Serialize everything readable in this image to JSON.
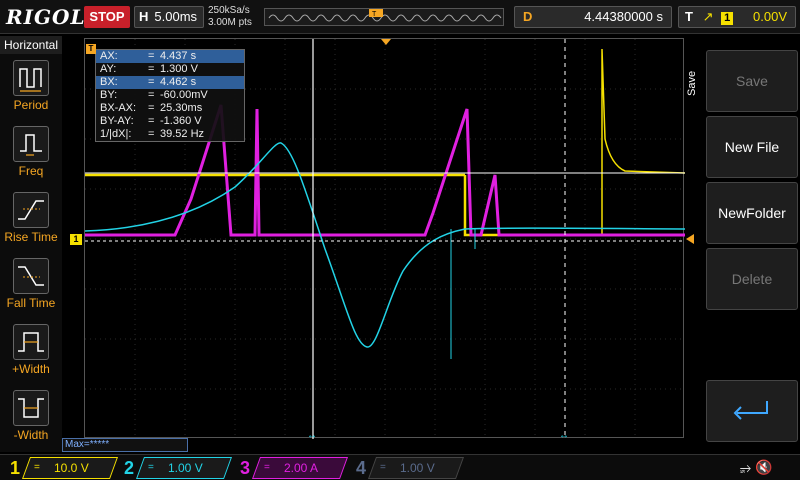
{
  "header": {
    "brand": "RIGOL",
    "run_state": "STOP",
    "timebase_label": "H",
    "timebase_value": "5.00ms",
    "sample_rate": "250kSa/s",
    "memory_depth": "3.00M pts",
    "delay_label": "D",
    "delay_value": "4.44380000 s",
    "trigger_label": "T",
    "trigger_source": "1",
    "trigger_level": "0.00V"
  },
  "left_menu": {
    "title": "Horizontal",
    "items": [
      {
        "label": "Period",
        "icon": "period-icon"
      },
      {
        "label": "Freq",
        "icon": "frequency-icon"
      },
      {
        "label": "Rise Time",
        "icon": "rise-time-icon"
      },
      {
        "label": "Fall Time",
        "icon": "fall-time-icon"
      },
      {
        "label": "+Width",
        "icon": "positive-width-icon"
      },
      {
        "label": "-Width",
        "icon": "negative-width-icon"
      }
    ]
  },
  "cursor_readout": [
    {
      "name": "AX:",
      "value": "4.437 s",
      "selected": true
    },
    {
      "name": "AY:",
      "value": "1.300 V",
      "selected": false
    },
    {
      "name": "BX:",
      "value": "4.462 s",
      "selected": true
    },
    {
      "name": "BY:",
      "value": "-60.00mV",
      "selected": false
    },
    {
      "name": "BX-AX:",
      "value": "25.30ms",
      "selected": false
    },
    {
      "name": "BY-AY:",
      "value": "-1.360 V",
      "selected": false
    },
    {
      "name": "1/|dX|:",
      "value": "39.52 Hz",
      "selected": false
    }
  ],
  "markers": {
    "trigger_marker": "T",
    "ch1_marker": "1"
  },
  "max_bar": "Max=*****",
  "right_menu": {
    "title": "Save",
    "buttons": [
      {
        "label": "Save",
        "enabled": false
      },
      {
        "label": "New File",
        "enabled": true
      },
      {
        "label": "NewFolder",
        "enabled": true
      },
      {
        "label": "Delete",
        "enabled": false
      },
      {
        "label": "",
        "enabled": true,
        "icon": "return-arrow-icon"
      }
    ]
  },
  "channels": [
    {
      "num": "1",
      "coupling": "=",
      "scale": "10.0 V",
      "color": "#f5e000"
    },
    {
      "num": "2",
      "coupling": "=",
      "scale": "1.00 V",
      "color": "#22d3e6"
    },
    {
      "num": "3",
      "coupling": "=",
      "scale": "2.00 A",
      "color": "#e020e0"
    },
    {
      "num": "4",
      "coupling": "=",
      "scale": "1.00 V",
      "color": "#5a6b8c"
    }
  ],
  "colors": {
    "ch1": "#f5e000",
    "ch2": "#22d3e6",
    "ch3": "#e020e0",
    "trigger": "#f5a623",
    "stop": "#c8202a"
  }
}
